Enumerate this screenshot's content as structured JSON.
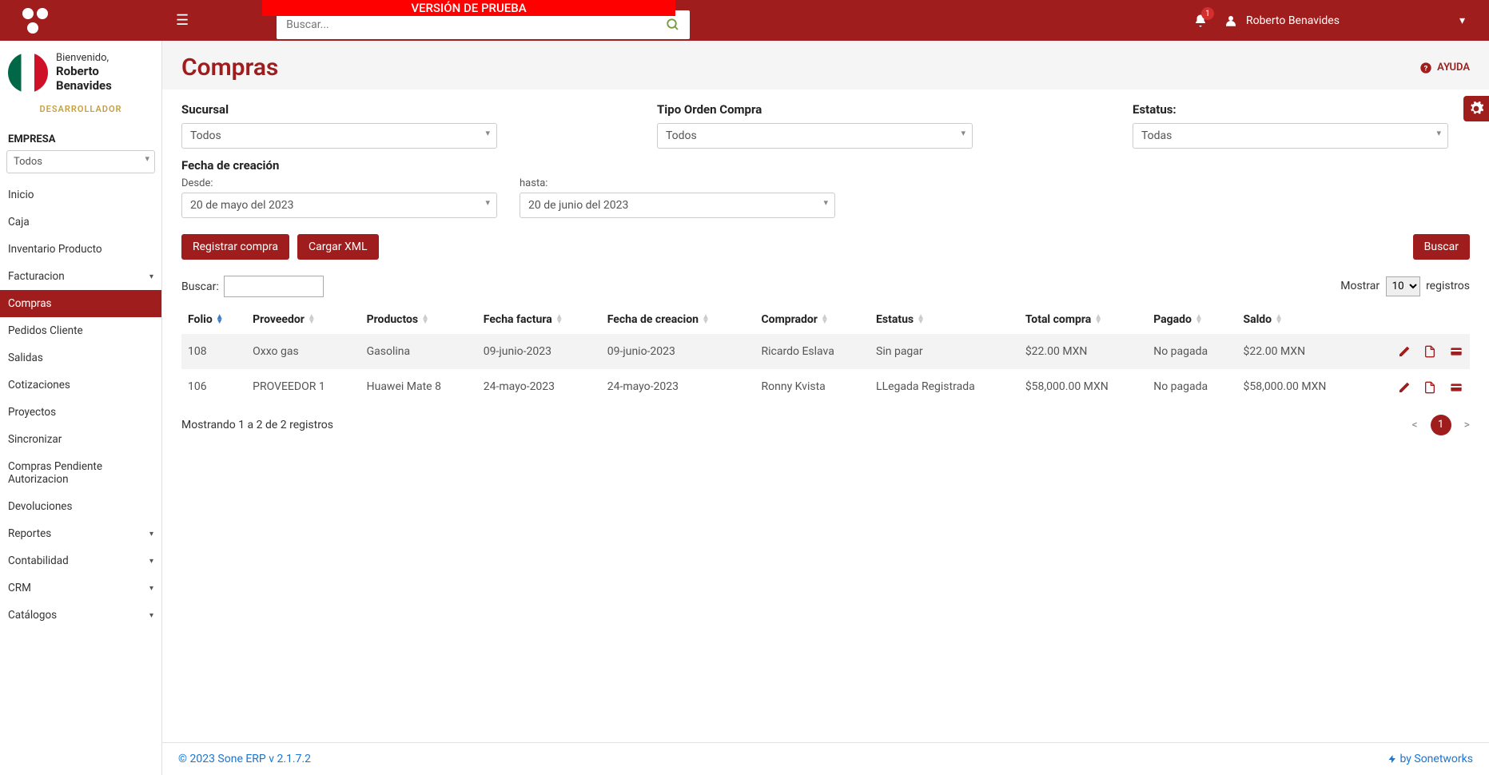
{
  "header": {
    "trial_banner": "VERSIÓN DE PRUEBA",
    "search_placeholder": "Buscar...",
    "notification_count": "1",
    "username": "Roberto Benavides"
  },
  "sidebar": {
    "welcome": "Bienvenido,",
    "user_name": "Roberto Benavides",
    "role": "DESARROLLADOR",
    "company_label": "EMPRESA",
    "company_value": "Todos",
    "items": [
      {
        "label": "Inicio",
        "caret": false
      },
      {
        "label": "Caja",
        "caret": false
      },
      {
        "label": "Inventario Producto",
        "caret": false
      },
      {
        "label": "Facturacion",
        "caret": true
      },
      {
        "label": "Compras",
        "caret": false,
        "active": true
      },
      {
        "label": "Pedidos Cliente",
        "caret": false
      },
      {
        "label": "Salidas",
        "caret": false
      },
      {
        "label": "Cotizaciones",
        "caret": false
      },
      {
        "label": "Proyectos",
        "caret": false
      },
      {
        "label": "Sincronizar",
        "caret": false
      },
      {
        "label": "Compras Pendiente Autorizacion",
        "caret": false
      },
      {
        "label": "Devoluciones",
        "caret": false
      },
      {
        "label": "Reportes",
        "caret": true
      },
      {
        "label": "Contabilidad",
        "caret": true
      },
      {
        "label": "CRM",
        "caret": true
      },
      {
        "label": "Catálogos",
        "caret": true
      }
    ]
  },
  "page": {
    "title": "Compras",
    "help": "AYUDA"
  },
  "filters": {
    "sucursal_label": "Sucursal",
    "sucursal_value": "Todos",
    "tipo_label": "Tipo Orden Compra",
    "tipo_value": "Todos",
    "estatus_label": "Estatus:",
    "estatus_value": "Todas",
    "fecha_label": "Fecha de creación",
    "desde_label": "Desde:",
    "desde_value": "20 de mayo del  2023",
    "hasta_label": "hasta:",
    "hasta_value": "20 de junio del  2023"
  },
  "buttons": {
    "registrar": "Registrar compra",
    "cargar_xml": "Cargar XML",
    "buscar": "Buscar"
  },
  "table": {
    "search_label": "Buscar:",
    "show_prefix": "Mostrar",
    "show_value": "10",
    "show_suffix": "registros",
    "columns": [
      "Folio",
      "Proveedor",
      "Productos",
      "Fecha factura",
      "Fecha de creacion",
      "Comprador",
      "Estatus",
      "Total compra",
      "Pagado",
      "Saldo"
    ],
    "rows": [
      {
        "folio": "108",
        "proveedor": "Oxxo gas",
        "productos": "Gasolina",
        "fecha_factura": "09-junio-2023",
        "fecha_creacion": "09-junio-2023",
        "comprador": "Ricardo Eslava",
        "estatus": "Sin pagar",
        "total": "$22.00 MXN",
        "pagado": "No pagada",
        "saldo": "$22.00 MXN"
      },
      {
        "folio": "106",
        "proveedor": "PROVEEDOR 1",
        "productos": "Huawei Mate 8",
        "fecha_factura": "24-mayo-2023",
        "fecha_creacion": "24-mayo-2023",
        "comprador": "Ronny Kvista",
        "estatus": "LLegada Registrada",
        "total": "$58,000.00 MXN",
        "pagado": "No pagada",
        "saldo": "$58,000.00 MXN"
      }
    ],
    "info": "Mostrando 1 a 2 de 2 registros",
    "page": "1"
  },
  "footer": {
    "copyright": "© 2023 Sone ERP v 2.1.7.2",
    "by": "by Sonetworks"
  }
}
